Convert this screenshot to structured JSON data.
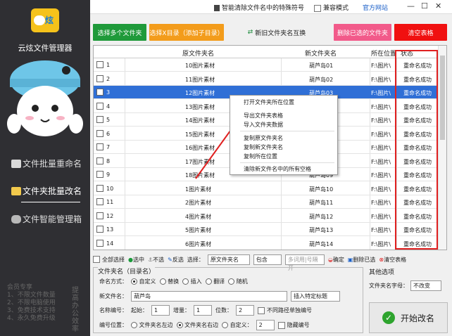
{
  "app": {
    "name": "云炫文件管理器",
    "logo_text": "炫"
  },
  "top": {
    "smart_clear": "智能清除文件名中的特殊符号",
    "compat_mode": "兼容模式",
    "official_site": "官方网站"
  },
  "nav": [
    {
      "label": "文件批量重命名",
      "icon": "file-icon",
      "active": false
    },
    {
      "label": "文件夹批量改名",
      "icon": "folder-icon",
      "active": true
    },
    {
      "label": "文件智能管理箱",
      "icon": "gamepad-icon",
      "active": false
    }
  ],
  "promo": {
    "lines": [
      "会员专享",
      "1、不限文件数量",
      "2、不限电脑使用",
      "3、免费技术支持",
      "4、永久免费升级"
    ],
    "side": "提高办公效率"
  },
  "buttons": {
    "select_multi": "选择多个文件夹",
    "select_sub": "选择X目录（添加子目录）",
    "swap": "新旧文件夹名互换",
    "delete_selected": "删除已选的文件夹",
    "clear_table": "清空表格"
  },
  "table": {
    "headers": [
      "",
      "原文件夹名",
      "新文件夹名",
      "所在位置",
      "状态"
    ],
    "rows": [
      {
        "n": "1",
        "orig": "10图片素材",
        "new": "葫芦岛01",
        "loc": "F:\\图片\\",
        "status": "重命名成功"
      },
      {
        "n": "2",
        "orig": "11图片素材",
        "new": "葫芦岛02",
        "loc": "F:\\图片\\",
        "status": "重命名成功"
      },
      {
        "n": "3",
        "orig": "12图片素材",
        "new": "葫芦岛03",
        "loc": "F:\\图片\\",
        "status": "重命名成功"
      },
      {
        "n": "4",
        "orig": "13图片素材",
        "new": "葫芦岛04",
        "loc": "F:\\图片\\",
        "status": "重命名成功"
      },
      {
        "n": "5",
        "orig": "14图片素材",
        "new": "葫芦岛05",
        "loc": "F:\\图片\\",
        "status": "重命名成功"
      },
      {
        "n": "6",
        "orig": "15图片素材",
        "new": "葫芦岛06",
        "loc": "F:\\图片\\",
        "status": "重命名成功"
      },
      {
        "n": "7",
        "orig": "16图片素材",
        "new": "葫芦岛07",
        "loc": "F:\\图片\\",
        "status": "重命名成功"
      },
      {
        "n": "8",
        "orig": "17图片素材",
        "new": "葫芦岛08",
        "loc": "F:\\图片\\",
        "status": "重命名成功"
      },
      {
        "n": "9",
        "orig": "18图片素材",
        "new": "葫芦岛09",
        "loc": "F:\\图片\\",
        "status": "重命名成功"
      },
      {
        "n": "10",
        "orig": "1图片素材",
        "new": "葫芦岛10",
        "loc": "F:\\图片\\",
        "status": "重命名成功"
      },
      {
        "n": "11",
        "orig": "2图片素材",
        "new": "葫芦岛11",
        "loc": "F:\\图片\\",
        "status": "重命名成功"
      },
      {
        "n": "12",
        "orig": "4图片素材",
        "new": "葫芦岛12",
        "loc": "F:\\图片\\",
        "status": "重命名成功"
      },
      {
        "n": "13",
        "orig": "5图片素材",
        "new": "葫芦岛13",
        "loc": "F:\\图片\\",
        "status": "重命名成功"
      },
      {
        "n": "14",
        "orig": "6图片素材",
        "new": "葫芦岛14",
        "loc": "F:\\图片\\",
        "status": "重命名成功"
      }
    ]
  },
  "context_menu": [
    "打开文件夹所在位置",
    "导出文件夹表格",
    "导入文件夹数据",
    "复制原文件夹名",
    "复制新文件夹名",
    "复制所在位置",
    "清除新文件名中的所有空格"
  ],
  "filter": {
    "select_all": "全部选择",
    "select": "选中",
    "deselect": "不选",
    "invert": "反选",
    "choose_label": "选择：",
    "field": "原文件夹名",
    "match": "包含",
    "placeholder": "多词用|号隔开",
    "confirm": "确定",
    "delete_selected": "删除已选",
    "clear_table": "清空表格"
  },
  "options": {
    "group_title": "文件夹名（目录名）",
    "naming_mode_label": "命名方式：",
    "modes": [
      "自定义",
      "替换",
      "插入",
      "翻译",
      "随机"
    ],
    "new_name_label": "新文件名：",
    "new_name_value": "葫芦岛",
    "insert_tag": "插入特定标题",
    "number_label": "名称编号：",
    "start_label": "起始：",
    "start_value": "1",
    "step_label": "增量：",
    "step_value": "1",
    "digits_label": "位数：",
    "digits_value": "2",
    "diff_path": "不同路径单独编号",
    "pos_label": "编号位置：",
    "pos_left": "文件夹名左边",
    "pos_right": "文件夹名右边",
    "pos_custom": "自定义：",
    "pos_custom_value": "2",
    "hide_number": "隐藏编号"
  },
  "other": {
    "title": "其他选项",
    "case_label": "文件夹名字母：",
    "case_value": "不改变"
  },
  "start_button": "开始改名"
}
